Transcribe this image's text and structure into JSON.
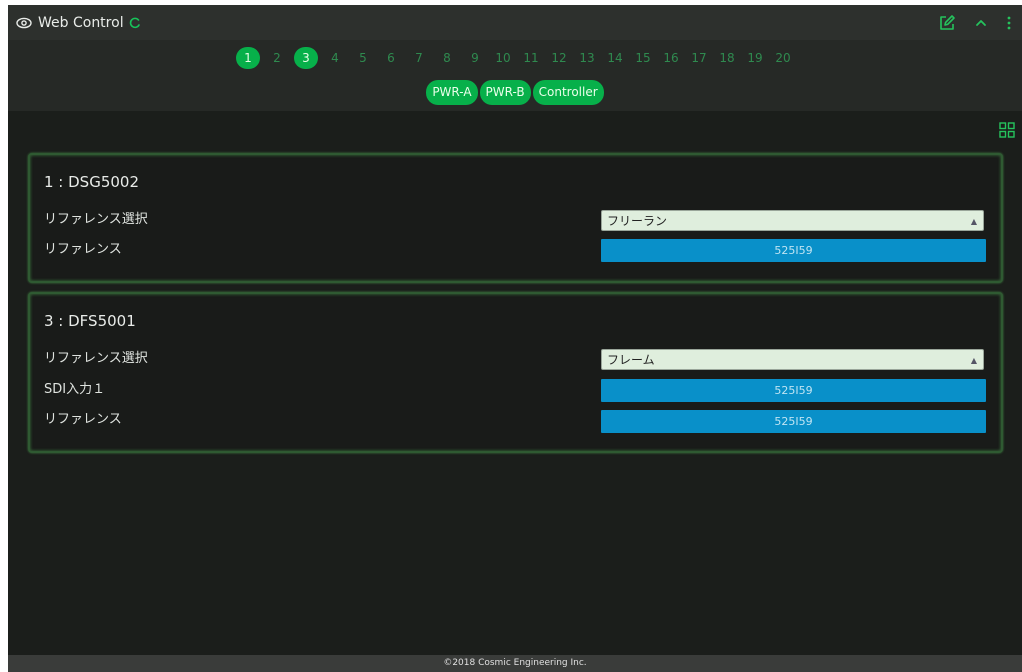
{
  "header": {
    "title": "Web Control",
    "icons": [
      "eye-icon",
      "loading-spinner-icon",
      "edit-icon",
      "chevron-up-icon",
      "more-vertical-icon"
    ],
    "accent_color": "#07b04a"
  },
  "pages": {
    "numbers": [
      "1",
      "2",
      "3",
      "4",
      "5",
      "6",
      "7",
      "8",
      "9",
      "10",
      "11",
      "12",
      "13",
      "14",
      "15",
      "16",
      "17",
      "18",
      "19",
      "20"
    ],
    "active": [
      "1",
      "3"
    ]
  },
  "device_tabs": [
    "PWR-A",
    "PWR-B",
    "Controller"
  ],
  "cards": [
    {
      "title": "1 : DSG5002",
      "rows": [
        {
          "label": "リファレンス選択",
          "type": "select",
          "value": "フリーラン"
        },
        {
          "label": "リファレンス",
          "type": "value",
          "value": "525I59"
        }
      ]
    },
    {
      "title": "3 : DFS5001",
      "rows": [
        {
          "label": "リファレンス選択",
          "type": "select",
          "value": "フレーム"
        },
        {
          "label": "SDI入力１",
          "type": "value",
          "value": "525I59"
        },
        {
          "label": "リファレンス",
          "type": "value",
          "value": "525I59"
        }
      ]
    }
  ],
  "footer": "©2018 Cosmic Engineering Inc."
}
